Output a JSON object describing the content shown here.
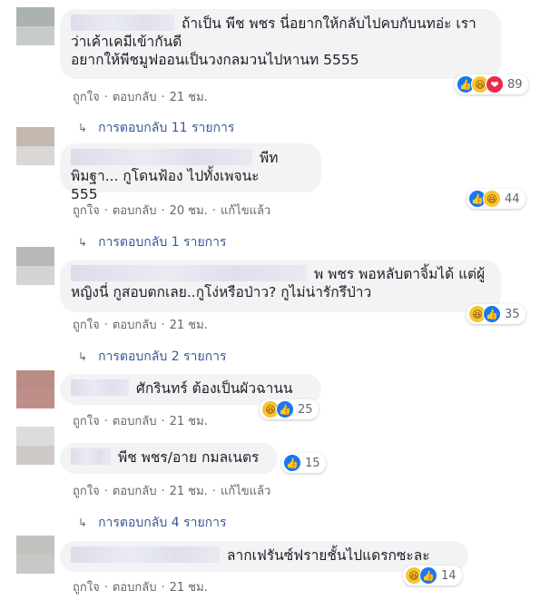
{
  "colors": {
    "accent": "#1877f2",
    "link": "#385898",
    "bubble": "#f2f3f5",
    "meta": "#606770"
  },
  "comments": [
    {
      "text_line1": "ถ้าเป็น พีช พชร นี่อยากให้กลับไปคบกับนทอ่ะ เรา",
      "text_line2": "ว่าเค้าเคมีเข้ากันดี",
      "text_line3": "อยากให้พีชมูฟออนเป็นวงกลมวนไปหานท 5555",
      "reactions": [
        "like-icon",
        "haha-icon",
        "love-icon"
      ],
      "count": "89",
      "like": "ถูกใจ",
      "reply": "ตอบกลับ",
      "time": "21 ชม.",
      "edited": "",
      "replies": "การตอบกลับ 11 รายการ"
    },
    {
      "text_line1": "พีท พิมฐา... กูโดนฟ้อง ไปทั้งเพจนะ",
      "text_line2": "555",
      "reactions": [
        "like-icon",
        "haha-icon"
      ],
      "count": "44",
      "like": "ถูกใจ",
      "reply": "ตอบกลับ",
      "time": "20 ชม.",
      "edited": "แก้ไขแล้ว",
      "replies": "การตอบกลับ 1 รายการ"
    },
    {
      "text_line1": "พ พชร พอหลับตาจิ้มได้ แต่ผู้",
      "text_line2": "หญิงนี่ กูสอบตกเลย..กูโง่หรือป่าว? กูไม่น่ารักรึป่าว",
      "reactions": [
        "haha-icon",
        "like-icon"
      ],
      "count": "35",
      "like": "ถูกใจ",
      "reply": "ตอบกลับ",
      "time": "21 ชม.",
      "edited": "",
      "replies": "การตอบกลับ 2 รายการ"
    },
    {
      "text_line1": "ศักรินทร์ ต้องเป็นผัวฉานน",
      "reactions": [
        "haha-icon",
        "like-icon"
      ],
      "count": "25",
      "like": "ถูกใจ",
      "reply": "ตอบกลับ",
      "time": "21 ชม.",
      "edited": "",
      "replies": ""
    },
    {
      "text_line1": "พีช พชร/อาย กมลเนตร",
      "reactions": [
        "like-icon"
      ],
      "count": "15",
      "like": "ถูกใจ",
      "reply": "ตอบกลับ",
      "time": "21 ชม.",
      "edited": "แก้ไขแล้ว",
      "replies": "การตอบกลับ 4 รายการ"
    },
    {
      "text_line1": "ลากเฟรันซ์ฟรายชั้นไปแดรกซะละ",
      "reactions": [
        "haha-icon",
        "like-icon"
      ],
      "count": "14",
      "like": "ถูกใจ",
      "reply": "ตอบกลับ",
      "time": "21 ชม.",
      "edited": "",
      "replies": ""
    }
  ]
}
